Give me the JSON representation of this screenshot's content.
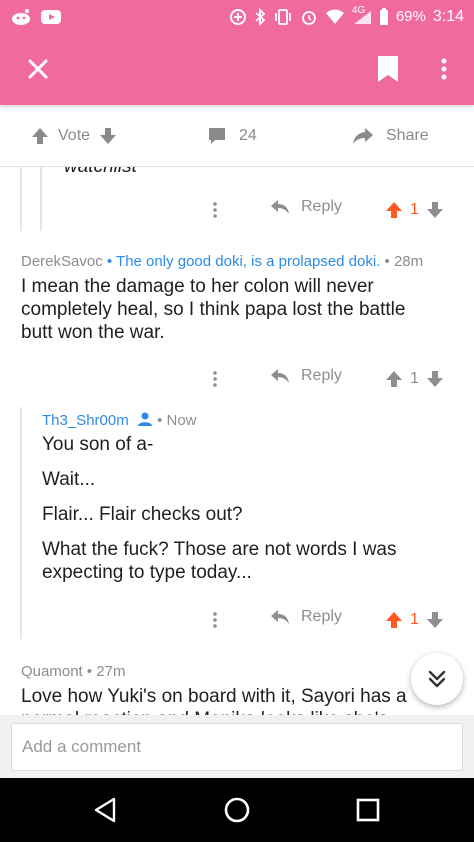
{
  "status_bar": {
    "network": "4G",
    "battery": "69%",
    "time": "3:14"
  },
  "action_row": {
    "vote_label": "Vote",
    "comment_count": "24",
    "share_label": "Share"
  },
  "comments": [
    {
      "truncated_text": "watchlist",
      "reply_label": "Reply",
      "score": "1"
    },
    {
      "author": "DerekSavoc",
      "flair": "The only good doki, is a prolapsed doki.",
      "time": "28m",
      "paragraphs": [
        "I mean the damage to her colon will never completely heal, so I think papa lost the battle butt won the war."
      ],
      "reply_label": "Reply",
      "score": "1"
    },
    {
      "author": "Th3_Shr00m",
      "time": "Now",
      "paragraphs": [
        "You son of a-",
        "Wait...",
        "Flair... Flair checks out?",
        "What the fuck? Those are not words I was expecting to type today..."
      ],
      "reply_label": "Reply",
      "score": "1"
    },
    {
      "author": "Quamont",
      "time": "27m",
      "paragraphs": [
        "Love how Yuki's on board with it, Sayori has a normal reaction and Monika looks like she's"
      ]
    }
  ],
  "composer": {
    "placeholder": "Add a comment"
  },
  "colors": {
    "accent": "#f16a9e",
    "upvote_active": "#ff5a1f",
    "link_blue": "#2c8be8"
  }
}
